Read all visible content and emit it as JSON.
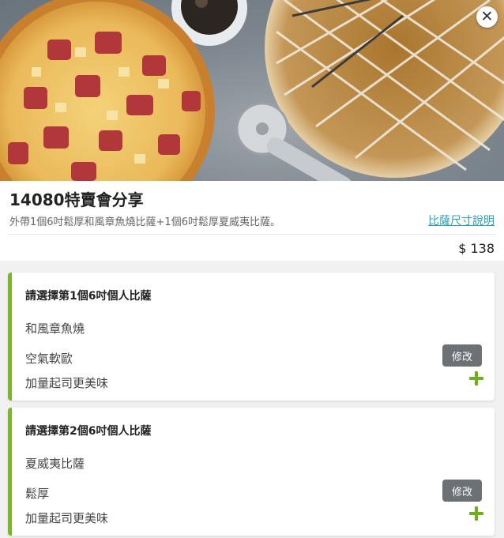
{
  "product": {
    "title": "14080特賣會分享",
    "description": "外帶1個6吋鬆厚和風章魚燒比薩+1個6吋鬆厚夏威夷比薩。",
    "size_link": "比薩尺寸說明",
    "price": "$ 138"
  },
  "icons": {
    "close": "close-icon",
    "add": "plus-icon"
  },
  "colors": {
    "accent": "#7ab62c",
    "link": "#2aa1bf",
    "edit_button": "#6c7175"
  },
  "selections": [
    {
      "title": "請選擇第1個6吋個人比薩",
      "pizza": "和風章魚燒",
      "crust": "空氣軟歐",
      "extra": "加量起司更美味",
      "edit_label": "修改"
    },
    {
      "title": "請選擇第2個6吋個人比薩",
      "pizza": "夏威夷比薩",
      "crust": "鬆厚",
      "extra": "加量起司更美味",
      "edit_label": "修改"
    }
  ]
}
